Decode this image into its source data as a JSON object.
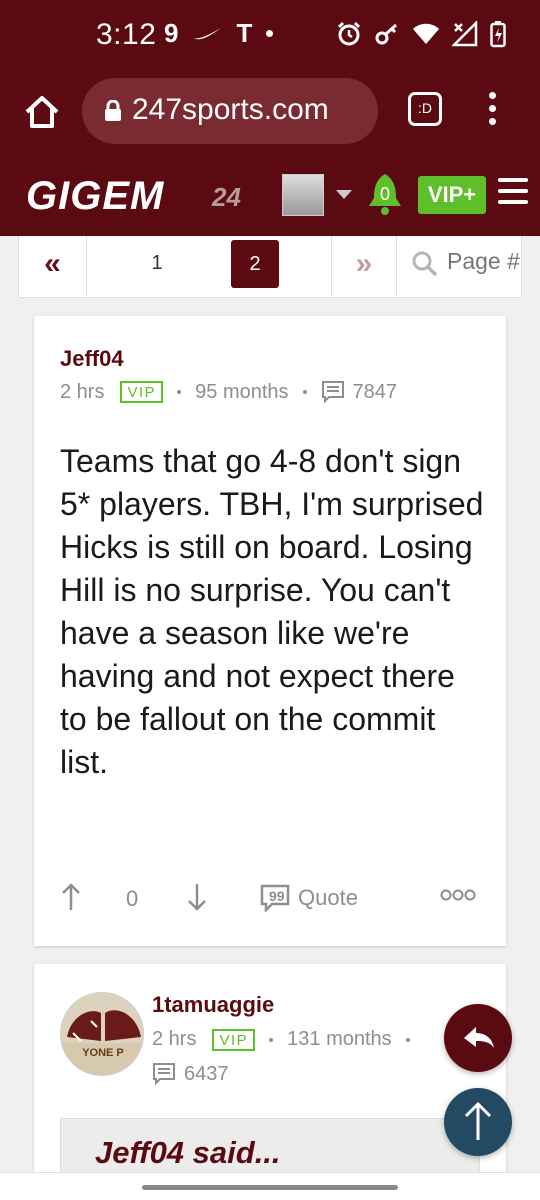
{
  "status_bar": {
    "time": "3:12",
    "left_icons": [
      "9",
      "nike-swoosh-icon",
      "T",
      "dot"
    ],
    "right_icons": [
      "alarm-icon",
      "key-icon",
      "wifi-icon",
      "no-signal-icon",
      "battery-icon"
    ]
  },
  "browser": {
    "url": "247sports.com",
    "tab_label": ":D"
  },
  "site": {
    "logo_text": "GIGEM",
    "logo_suffix": "24",
    "notifications_count": "0",
    "vip_label": "VIP+"
  },
  "pagination": {
    "first_label": "«",
    "page_1": "1",
    "page_2": "2",
    "next_label": "»",
    "search_placeholder": "Page #"
  },
  "post1": {
    "username": "Jeff04",
    "time": "2 hrs",
    "badge": "VIP",
    "tenure": "95 months",
    "post_count": "7847",
    "body": "Teams that go 4-8 don't sign 5* players. TBH, I'm surprised Hicks is still on board. Losing Hill is no surprise. You can't have a season like we're having and not expect there to be fallout on the commit list.",
    "vote_count": "0",
    "quote_label": "Quote"
  },
  "post2": {
    "username": "1tamuaggie",
    "time": "2 hrs",
    "badge": "VIP",
    "tenure": "131 months",
    "post_count": "6437",
    "quote_header": "Jeff04 said...",
    "avatar_text": "YONE P"
  },
  "colors": {
    "brand": "#5c0a12",
    "vip_green": "#5fbf2a",
    "fab_blue": "#244a63"
  }
}
